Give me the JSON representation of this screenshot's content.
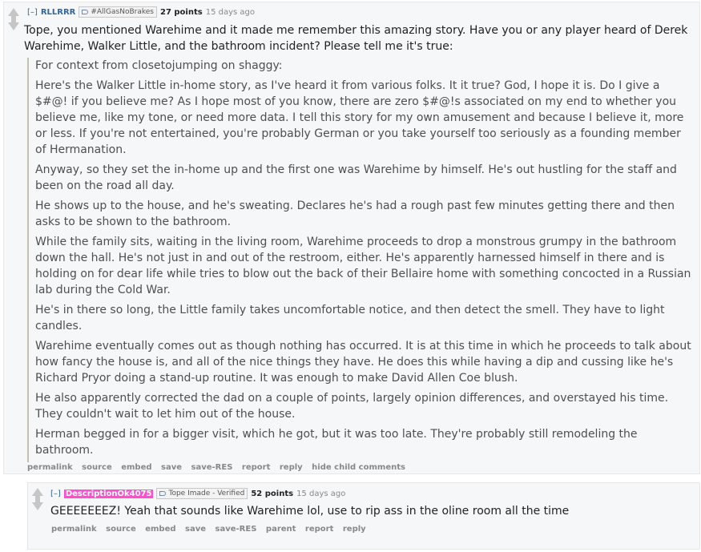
{
  "parent": {
    "expand": "[–]",
    "author": "RLLRRR",
    "flair": "#AllGasNoBrakes",
    "score": "27 points",
    "time": "15 days ago",
    "body": "Tope, you mentioned Warehime and it made me remember this amazing story. Have you or any player heard of Derek Warehime, Walker Little, and the bathroom incident? Please tell me it's true:",
    "quote": [
      "For context from closetojumping on shaggy:",
      "Here's the Walker Little in-home story, as I've heard it from various folks. It it true? God, I hope it is. Do I give a $#@! if you believe me? As I hope most of you know, there are zero $#@!s associated on my end to whether you believe me, like my tone, or need more data. I tell this story for my own amusement and because I believe it, more or less. If you're not entertained, you're probably German or you take yourself too seriously as a founding member of Hermanation.",
      "Anyway, so they set the in-home up and the first one was Warehime by himself. He's out hustling for the staff and been on the road all day.",
      "He shows up to the house, and he's sweating. Declares he's had a rough past few minutes getting there and then asks to be shown to the bathroom.",
      "While the family sits, waiting in the living room, Warehime proceeds to drop a monstrous grumpy in the bathroom down the hall. He's not just in and out of the restroom, either. He's apparently harnessed himself in there and is holding on for dear life while tries to blow out the back of their Bellaire home with something concocted in a Russian lab during the Cold War.",
      "He's in there so long, the Little family takes uncomfortable notice, and then detect the smell. They have to light candles.",
      "Warehime eventually comes out as though nothing has occurred. It is at this time in which he proceeds to talk about how fancy the house is, and all of the nice things they have. He does this while having a dip and cussing like he's Richard Pryor doing a stand-up routine. It was enough to make David Allen Coe blush.",
      "He also apparently corrected the dad on a couple of points, largely opinion differences, and overstayed his time. They couldn't wait to let him out of the house.",
      "Herman begged in for a bigger visit, which he got, but it was too late. They're probably still remodeling the bathroom."
    ],
    "buttons": [
      "permalink",
      "source",
      "embed",
      "save",
      "save-RES",
      "report",
      "reply",
      "hide child comments"
    ]
  },
  "child": {
    "expand": "[–]",
    "author": "DescriptionOk4075",
    "flair": "Tope Imade - Verified",
    "score": "52 points",
    "time": "15 days ago",
    "body": "GEEEEEEEZ! Yeah that sounds like Warehime lol, use to rip ass in the oline room all the time",
    "buttons": [
      "permalink",
      "source",
      "embed",
      "save",
      "save-RES",
      "parent",
      "report",
      "reply"
    ]
  }
}
